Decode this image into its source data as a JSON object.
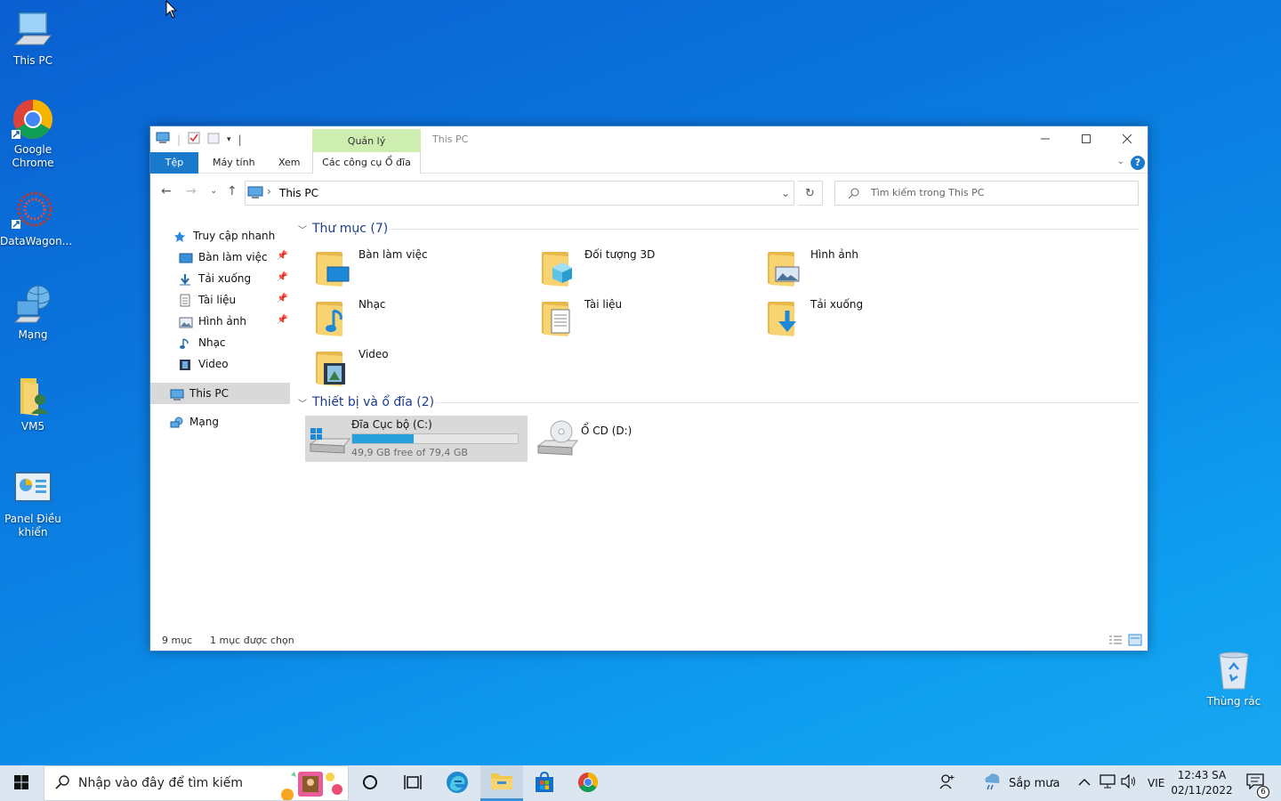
{
  "desktop": {
    "icons": [
      {
        "label": "This PC",
        "icon": "computer-icon"
      },
      {
        "label": "Google Chrome",
        "icon": "chrome-icon"
      },
      {
        "label": "DataWagon...",
        "icon": "datawagon-icon"
      },
      {
        "label": "Mạng",
        "icon": "network-icon"
      },
      {
        "label": "VM5",
        "icon": "user-folder-icon"
      },
      {
        "label": "Panel Điều khiển",
        "icon": "control-panel-icon"
      },
      {
        "label": "Thùng rác",
        "icon": "recycle-bin-icon"
      }
    ]
  },
  "window": {
    "title": "This PC",
    "manage_tab": "Quản lý",
    "ribbon_tabs": [
      "Tệp",
      "Máy tính",
      "Xem",
      "Các công cụ Ổ đĩa"
    ],
    "help_label": "?",
    "address": {
      "path": "This PC",
      "separator": "›"
    },
    "search_placeholder": "Tìm kiếm trong This PC",
    "nav": {
      "quick_access": "Truy cập nhanh",
      "quick_items": [
        "Bàn làm việc",
        "Tải xuống",
        "Tài liệu",
        "Hình ảnh",
        "Nhạc",
        "Video"
      ],
      "this_pc": "This PC",
      "network": "Mạng"
    },
    "folders_group": "Thư mục (7)",
    "folders": [
      "Bàn làm việc",
      "Đối tượng 3D",
      "Hình ảnh",
      "Nhạc",
      "Tài liệu",
      "Tải xuống",
      "Video"
    ],
    "devices_group": "Thiết bị và ổ đĩa (2)",
    "drives": [
      {
        "name": "Đĩa Cục bộ (C:)",
        "free": "49,9 GB free of 79,4 GB",
        "used_fraction": 0.37
      },
      {
        "name": "Ổ CD (D:)"
      }
    ],
    "status": {
      "count": "9 mục",
      "selected": "1 mục được chọn"
    }
  },
  "taskbar": {
    "search_placeholder": "Nhập vào đây để tìm kiếm",
    "weather": "Sắp mưa",
    "language": "VIE",
    "time": "12:43 SA",
    "date": "02/11/2022",
    "notification_count": "6"
  },
  "colors": {
    "accent": "#1979ca",
    "selection": "#d9d9d9",
    "manage_tab": "#cdeeb0",
    "progress": "#26a0da"
  }
}
